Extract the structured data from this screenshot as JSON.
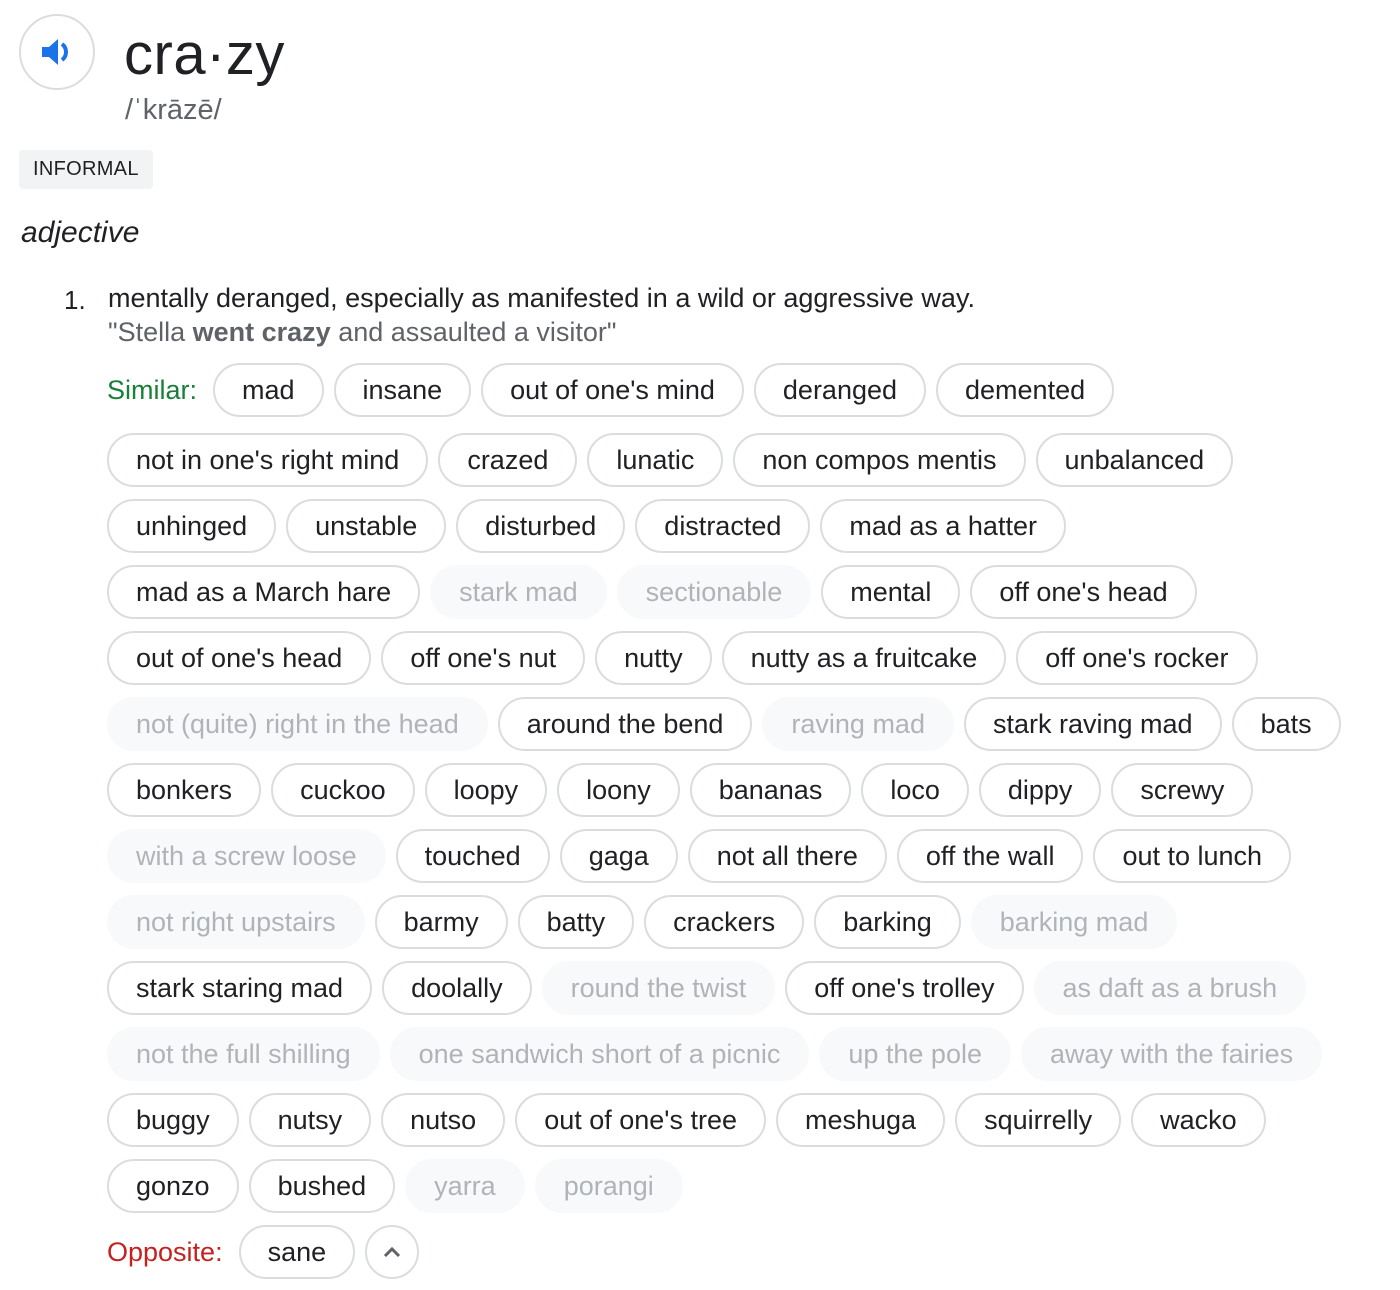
{
  "entry": {
    "headword": "cra·zy",
    "phonetic": "/ˈkrāzē/",
    "register": "INFORMAL",
    "part_of_speech": "adjective",
    "accent_color": "#1a73e8"
  },
  "senses": [
    {
      "number": "1.",
      "definition": "mentally deranged, especially as manifested in a wild or aggressive way.",
      "example": {
        "before": "\"Stella ",
        "bold": "went crazy",
        "after": " and assaulted a visitor\""
      }
    }
  ],
  "similar_label": "Similar:",
  "opposite_label": "Opposite:",
  "label_colors": {
    "similar": "#188038",
    "opposite": "#c5221f"
  },
  "synonym_rows": [
    [
      {
        "t": "mad",
        "m": false
      },
      {
        "t": "insane",
        "m": false
      },
      {
        "t": "out of one's mind",
        "m": false
      },
      {
        "t": "deranged",
        "m": false
      },
      {
        "t": "demented",
        "m": false
      }
    ],
    [
      {
        "t": "not in one's right mind",
        "m": false
      },
      {
        "t": "crazed",
        "m": false
      },
      {
        "t": "lunatic",
        "m": false
      },
      {
        "t": "non compos mentis",
        "m": false
      },
      {
        "t": "unbalanced",
        "m": false
      }
    ],
    [
      {
        "t": "unhinged",
        "m": false
      },
      {
        "t": "unstable",
        "m": false
      },
      {
        "t": "disturbed",
        "m": false
      },
      {
        "t": "distracted",
        "m": false
      },
      {
        "t": "mad as a hatter",
        "m": false
      }
    ],
    [
      {
        "t": "mad as a March hare",
        "m": false
      },
      {
        "t": "stark mad",
        "m": true
      },
      {
        "t": "sectionable",
        "m": true
      },
      {
        "t": "mental",
        "m": false
      },
      {
        "t": "off one's head",
        "m": false
      }
    ],
    [
      {
        "t": "out of one's head",
        "m": false
      },
      {
        "t": "off one's nut",
        "m": false
      },
      {
        "t": "nutty",
        "m": false
      },
      {
        "t": "nutty as a fruitcake",
        "m": false
      },
      {
        "t": "off one's rocker",
        "m": false
      }
    ],
    [
      {
        "t": "not (quite) right in the head",
        "m": true
      },
      {
        "t": "around the bend",
        "m": false
      },
      {
        "t": "raving mad",
        "m": true
      },
      {
        "t": "stark raving mad",
        "m": false
      },
      {
        "t": "bats",
        "m": false
      }
    ],
    [
      {
        "t": "bonkers",
        "m": false
      },
      {
        "t": "cuckoo",
        "m": false
      },
      {
        "t": "loopy",
        "m": false
      },
      {
        "t": "loony",
        "m": false
      },
      {
        "t": "bananas",
        "m": false
      },
      {
        "t": "loco",
        "m": false
      },
      {
        "t": "dippy",
        "m": false
      },
      {
        "t": "screwy",
        "m": false
      }
    ],
    [
      {
        "t": "with a screw loose",
        "m": true
      },
      {
        "t": "touched",
        "m": false
      },
      {
        "t": "gaga",
        "m": false
      },
      {
        "t": "not all there",
        "m": false
      },
      {
        "t": "off the wall",
        "m": false
      },
      {
        "t": "out to lunch",
        "m": false
      }
    ],
    [
      {
        "t": "not right upstairs",
        "m": true
      },
      {
        "t": "barmy",
        "m": false
      },
      {
        "t": "batty",
        "m": false
      },
      {
        "t": "crackers",
        "m": false
      },
      {
        "t": "barking",
        "m": false
      },
      {
        "t": "barking mad",
        "m": true
      }
    ],
    [
      {
        "t": "stark staring mad",
        "m": false
      },
      {
        "t": "doolally",
        "m": false
      },
      {
        "t": "round the twist",
        "m": true
      },
      {
        "t": "off one's trolley",
        "m": false
      },
      {
        "t": "as daft as a brush",
        "m": true
      }
    ],
    [
      {
        "t": "not the full shilling",
        "m": true
      },
      {
        "t": "one sandwich short of a picnic",
        "m": true
      },
      {
        "t": "up the pole",
        "m": true
      },
      {
        "t": "away with the fairies",
        "m": true
      }
    ],
    [
      {
        "t": "buggy",
        "m": false
      },
      {
        "t": "nutsy",
        "m": false
      },
      {
        "t": "nutso",
        "m": false
      },
      {
        "t": "out of one's tree",
        "m": false
      },
      {
        "t": "meshuga",
        "m": false
      },
      {
        "t": "squirrelly",
        "m": false
      },
      {
        "t": "wacko",
        "m": false
      }
    ],
    [
      {
        "t": "gonzo",
        "m": false
      },
      {
        "t": "bushed",
        "m": false
      },
      {
        "t": "yarra",
        "m": true
      },
      {
        "t": "porangi",
        "m": true
      }
    ]
  ],
  "antonyms": [
    {
      "t": "sane",
      "m": false
    }
  ],
  "icons": {
    "pronounce": "speaker-icon",
    "collapse": "chevron-up-icon"
  }
}
